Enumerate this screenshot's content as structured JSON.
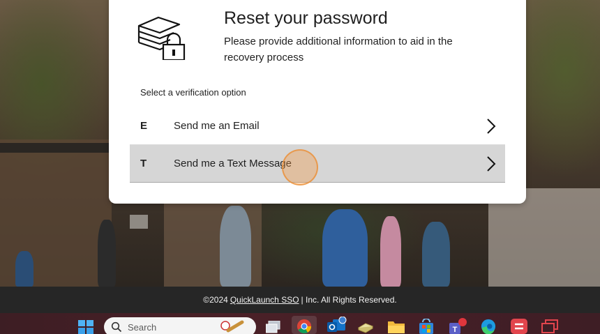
{
  "card": {
    "title": "Reset your password",
    "description": "Please provide additional information to aid in the recovery process",
    "select_label": "Select a verification option",
    "options": [
      {
        "letter": "E",
        "label": "Send me an Email"
      },
      {
        "letter": "T",
        "label": "Send me a Text Message"
      }
    ]
  },
  "footer": {
    "prefix": "©2024",
    "link_text": "QuickLaunch SSO",
    "suffix": "| Inc. All Rights Reserved."
  },
  "taskbar": {
    "search_placeholder": "Search",
    "icons": [
      "windows-start-icon",
      "search-icon",
      "task-view-icon",
      "chrome-icon",
      "outlook-icon",
      "notes-icon",
      "file-explorer-icon",
      "microsoft-store-icon",
      "teams-icon",
      "edge-icon",
      "app-red-icon",
      "app-window-icon"
    ]
  },
  "colors": {
    "selected_option_bg": "#d6d6d6",
    "footer_bg": "#262626",
    "click_marker": "#f3963c"
  }
}
